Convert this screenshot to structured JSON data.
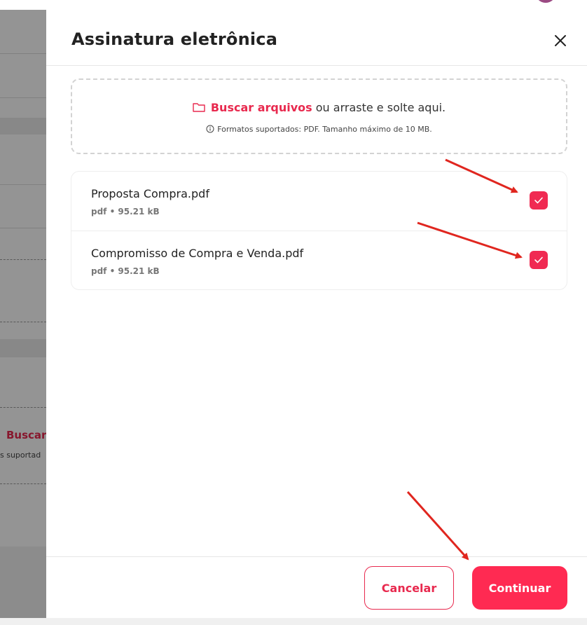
{
  "modal": {
    "title": "Assinatura eletrônica",
    "close_icon": "close-icon"
  },
  "dropzone": {
    "icon": "folder-icon",
    "link_label": "Buscar arquivos",
    "rest_label": " ou arraste e solte aqui.",
    "info_icon": "info-icon",
    "formats_text": "Formatos suportados: PDF. Tamanho máximo de 10 MB."
  },
  "files": [
    {
      "name": "Proposta Compra.pdf",
      "meta": "pdf • 95.21 kB",
      "checked": true
    },
    {
      "name": "Compromisso de Compra e Venda.pdf",
      "meta": "pdf • 95.21 kB",
      "checked": true
    }
  ],
  "footer": {
    "cancel_label": "Cancelar",
    "continue_label": "Continuar"
  },
  "background": {
    "buscar_fragment": "Buscar",
    "formatos_fragment": "s suportad"
  },
  "colors": {
    "accent": "#ff2a52",
    "annotation_arrow": "#e0261f",
    "overlay": "#000000"
  }
}
